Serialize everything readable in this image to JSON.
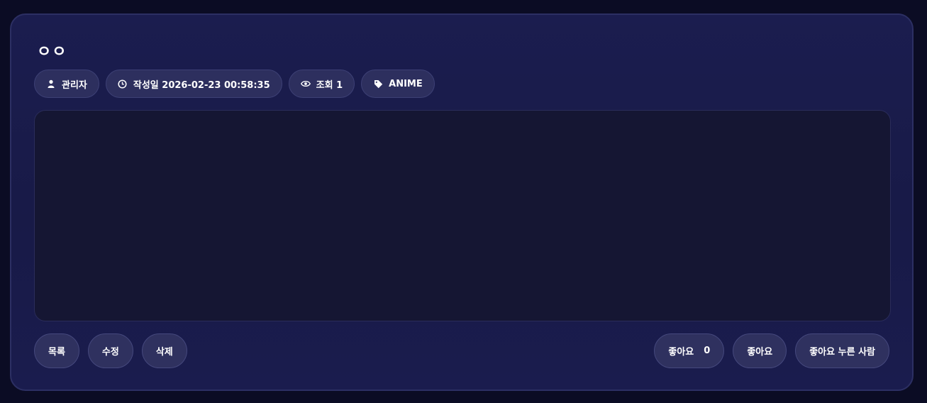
{
  "post": {
    "title": "ㅇㅇ",
    "author": "관리자",
    "created": "작성일 2026-02-23 00:58:35",
    "views": "조회 1",
    "category": "ANIME",
    "body": ""
  },
  "icons": {
    "author": "user-icon",
    "created": "clock-icon",
    "views": "eye-icon",
    "category": "tag-icon"
  },
  "actions": {
    "list": "목록",
    "edit": "수정",
    "delete": "삭제",
    "like_label": "좋아요",
    "like_count": "0",
    "like": "좋아요",
    "likers": "좋아요 누른 사람"
  },
  "colors": {
    "page_bg": "#0b0c24",
    "card_bg": "#1a1c4e",
    "pill_bg": "#2d2f5e",
    "content_bg": "#151633"
  }
}
